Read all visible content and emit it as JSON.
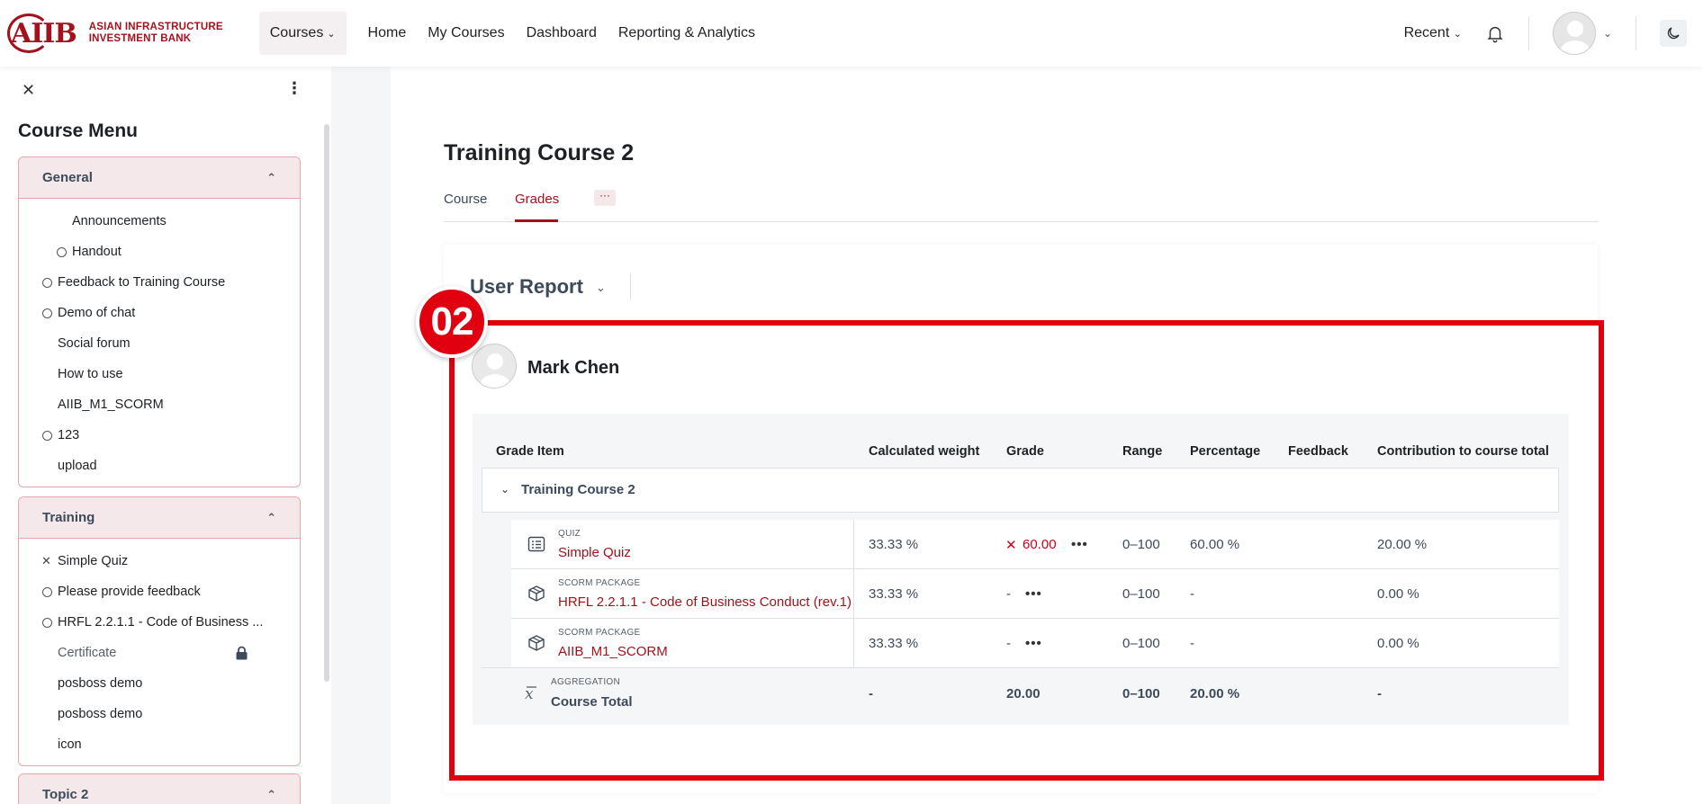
{
  "brand": {
    "mark": "AIIB",
    "line1": "ASIAN INFRASTRUCTURE",
    "line2": "INVESTMENT BANK",
    "color": "#a4111d"
  },
  "nav": {
    "courses": "Courses",
    "links": [
      "Home",
      "My Courses",
      "Dashboard",
      "Reporting & Analytics"
    ],
    "recent": "Recent"
  },
  "sidebar": {
    "title": "Course Menu",
    "sections": [
      {
        "title": "General",
        "items": [
          {
            "label": "Announcements",
            "mark": "none",
            "indent": true
          },
          {
            "label": "Handout",
            "mark": "circle",
            "indent": true
          },
          {
            "label": "Feedback to Training Course",
            "mark": "circle",
            "indent": false
          },
          {
            "label": "Demo of chat",
            "mark": "circle",
            "indent": false
          },
          {
            "label": "Social forum",
            "mark": "none",
            "indent": false
          },
          {
            "label": "How to use",
            "mark": "none",
            "indent": false
          },
          {
            "label": "AIIB_M1_SCORM",
            "mark": "none",
            "indent": false
          },
          {
            "label": "123",
            "mark": "circle",
            "indent": false
          },
          {
            "label": "upload",
            "mark": "none",
            "indent": false
          }
        ]
      },
      {
        "title": "Training",
        "items": [
          {
            "label": "Simple Quiz",
            "mark": "x",
            "indent": false
          },
          {
            "label": "Please provide feedback",
            "mark": "circle",
            "indent": false
          },
          {
            "label": "HRFL 2.2.1.1 - Code of Business ...",
            "mark": "circle",
            "indent": false
          },
          {
            "label": "Certificate",
            "mark": "none",
            "indent": false,
            "locked": true
          },
          {
            "label": "posboss demo",
            "mark": "none",
            "indent": false
          },
          {
            "label": "posboss demo",
            "mark": "none",
            "indent": false
          },
          {
            "label": "icon",
            "mark": "none",
            "indent": false
          }
        ]
      },
      {
        "title": "Topic 2",
        "items": []
      }
    ]
  },
  "page": {
    "title": "Training Course 2",
    "tabs": [
      "Course",
      "Grades"
    ],
    "active_tab": "Grades",
    "more": "···"
  },
  "report": {
    "title": "User Report",
    "badge": "02",
    "user": "Mark Chen",
    "headers": [
      "Grade Item",
      "Calculated weight",
      "Grade",
      "Range",
      "Percentage",
      "Feedback",
      "Contribution to course total"
    ],
    "category": "Training Course 2",
    "rows": [
      {
        "type": "QUIZ",
        "name": "Simple Quiz",
        "icon": "quiz-icon",
        "weight": "33.33 %",
        "grade": "60.00",
        "failed": true,
        "range": "0–100",
        "percentage": "60.00 %",
        "feedback": "",
        "contribution": "20.00 %"
      },
      {
        "type": "SCORM PACKAGE",
        "name": "HRFL 2.2.1.1 - Code of Business Conduct (rev.1)",
        "icon": "package-icon",
        "weight": "33.33 %",
        "grade": "-",
        "failed": false,
        "range": "0–100",
        "percentage": "-",
        "feedback": "",
        "contribution": "0.00 %"
      },
      {
        "type": "SCORM PACKAGE",
        "name": "AIIB_M1_SCORM",
        "icon": "package-icon",
        "weight": "33.33 %",
        "grade": "-",
        "failed": false,
        "range": "0–100",
        "percentage": "-",
        "feedback": "",
        "contribution": "0.00 %"
      }
    ],
    "total": {
      "type": "AGGREGATION",
      "name": "Course Total",
      "weight": "-",
      "grade": "20.00",
      "range": "0–100",
      "percentage": "20.00 %",
      "contribution": "-"
    }
  },
  "colors": {
    "accent": "#a4111d",
    "highlight": "#e0000f"
  }
}
